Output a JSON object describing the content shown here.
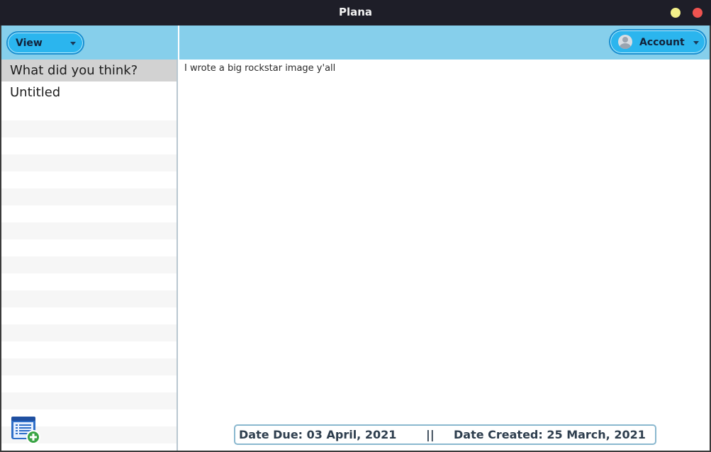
{
  "window": {
    "title": "Plana",
    "controls": [
      "minimize",
      "close"
    ],
    "colors": {
      "minimize": "#f3f08a",
      "close": "#ef5350",
      "header": "#86cfeb",
      "pill": "#2bb5ee"
    }
  },
  "sidebar": {
    "view_label": "View",
    "notes": [
      {
        "title": "What did you think?",
        "selected": true
      },
      {
        "title": "Untitled",
        "selected": false
      }
    ],
    "add_note_icon": "add-note-icon"
  },
  "header": {
    "account_label": "Account",
    "avatar_icon": "user-avatar-icon"
  },
  "note": {
    "body": "I wrote a big rockstar image y'all",
    "date_due": "Date Due: 03 April, 2021",
    "separator": "||",
    "date_created": "Date Created: 25 March, 2021"
  }
}
